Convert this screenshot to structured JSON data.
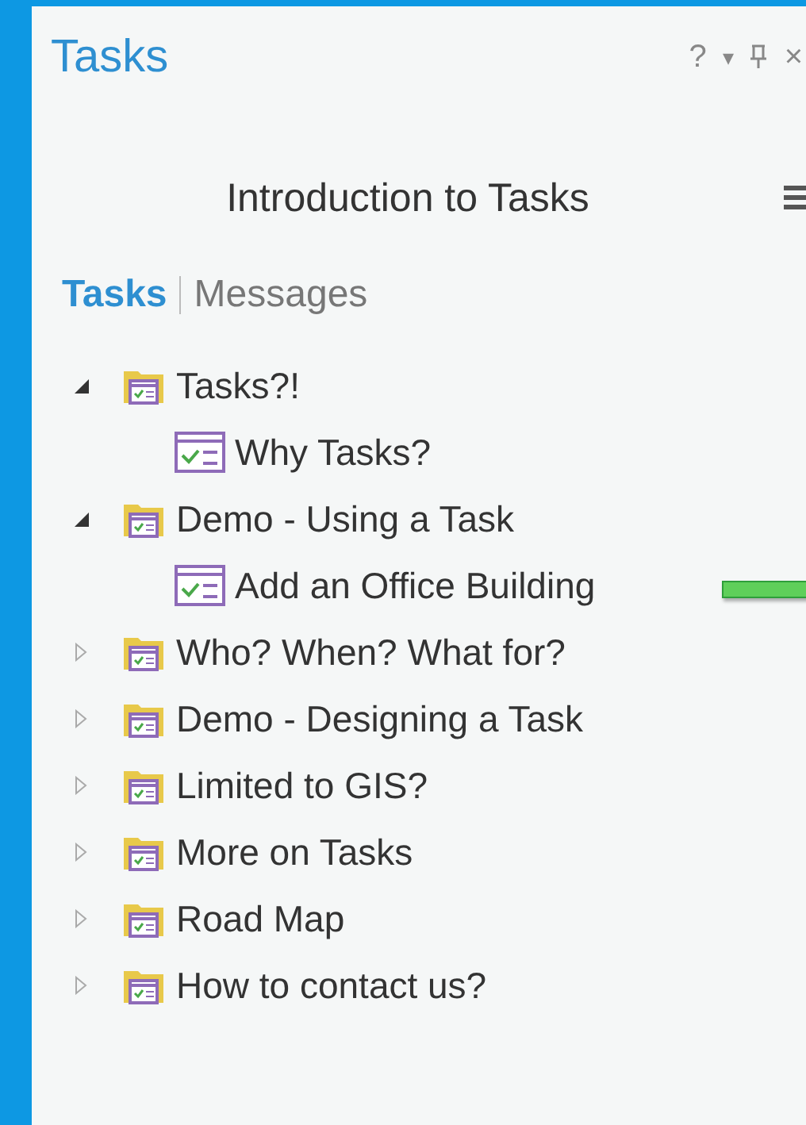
{
  "window": {
    "title": "Tasks",
    "controls": [
      "?",
      "▾",
      "×"
    ]
  },
  "header": {
    "title": "Introduction to Tasks"
  },
  "tabs": [
    {
      "label": "Tasks",
      "selected": true
    },
    {
      "label": "Messages",
      "selected": false
    }
  ],
  "tree": [
    {
      "label": "Tasks?!",
      "expanded": true,
      "children": [
        {
          "label": "Why Tasks?"
        }
      ]
    },
    {
      "label": "Demo - Using a Task",
      "expanded": true,
      "children": [
        {
          "label": "Add an Office Building"
        }
      ]
    },
    {
      "label": "Who? When? What for?",
      "expanded": false
    },
    {
      "label": "Demo - Designing a Task",
      "expanded": false
    },
    {
      "label": "Limited to GIS?",
      "expanded": false
    },
    {
      "label": "More on Tasks",
      "expanded": false
    },
    {
      "label": "Road Map",
      "expanded": false
    },
    {
      "label": "How to contact us?",
      "expanded": false
    }
  ]
}
